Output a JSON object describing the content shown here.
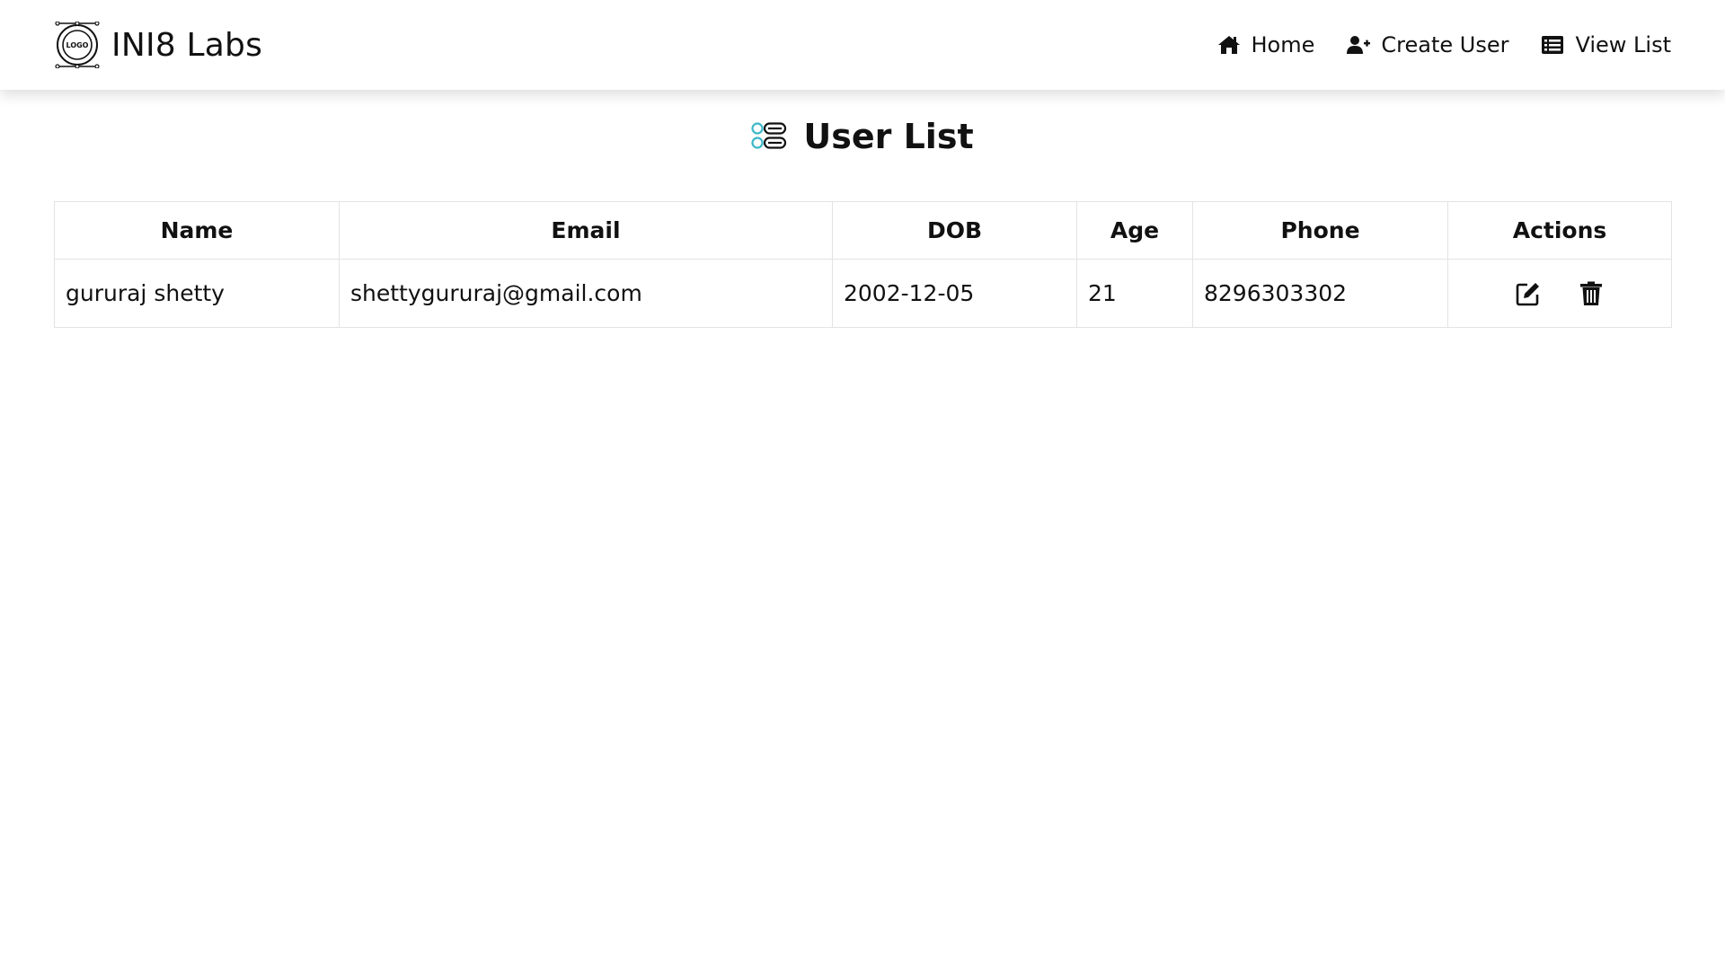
{
  "brand": {
    "name": "INI8 Labs",
    "logo_text": "LOGO",
    "logo_icon": "circular-logo-icon"
  },
  "nav": {
    "items": [
      {
        "label": "Home",
        "icon": "home-icon"
      },
      {
        "label": "Create User",
        "icon": "user-plus-icon"
      },
      {
        "label": "View List",
        "icon": "list-icon"
      }
    ]
  },
  "page": {
    "title": "User List",
    "title_icon": "list-toggle-icon",
    "accent_color": "#3bb8c9"
  },
  "table": {
    "headers": [
      "Name",
      "Email",
      "DOB",
      "Age",
      "Phone",
      "Actions"
    ],
    "rows": [
      {
        "name": "gururaj shetty",
        "email": "shettygururaj@gmail.com",
        "dob": "2002-12-05",
        "age": "21",
        "phone": "8296303302",
        "actions": [
          "edit-icon",
          "trash-icon"
        ]
      }
    ]
  }
}
